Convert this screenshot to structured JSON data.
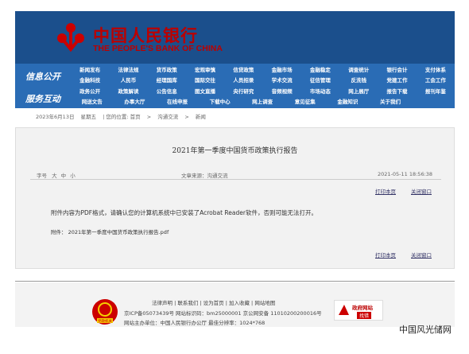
{
  "header": {
    "name_cn": "中国人民银行",
    "name_en": "THE PEOPLE'S BANK OF CHINA"
  },
  "nav": {
    "info_label": "信息公开",
    "service_label": "服务互动",
    "rows": [
      [
        "新闻发布",
        "法律法规",
        "货币政策",
        "宏观审慎",
        "信贷政策",
        "金融市场",
        "金融稳定",
        "调查统计",
        "银行会计",
        "支付体系"
      ],
      [
        "金融科技",
        "人民币",
        "经理国库",
        "国际交往",
        "人员招录",
        "学术交流",
        "征信管理",
        "反洗钱",
        "党建工作",
        "工会工作"
      ],
      [
        "政务公开",
        "政策解读",
        "公告信息",
        "图文直播",
        "央行研究",
        "音频视频",
        "市场动态",
        "网上展厅",
        "报告下载",
        "报刊年鉴"
      ],
      [
        "网送文告",
        "办事大厅",
        "在线申报",
        "下载中心",
        "网上调查",
        "意见征集",
        "金融知识",
        "关于我们",
        "",
        ""
      ]
    ]
  },
  "breadcrumb": {
    "date": "2023年6月13日",
    "weekday": "星期五",
    "location_label": "| 您的位置: 首页",
    "sep1": ">",
    "section": "沟通交流",
    "sep2": ">",
    "current": "新闻"
  },
  "article": {
    "title": "2021年第一季度中国货币政策执行报告",
    "font_size_label": "字号",
    "size_large": "大",
    "size_medium": "中",
    "size_small": "小",
    "source": "文章来源：沟通交流",
    "datetime": "2021-05-11  18:56:38",
    "print_label": "打印本页",
    "close_label": "关闭窗口",
    "notice": "附件内容为PDF格式，请确认您的计算机系统中已安装了Acrobat Reader软件，否则可能无法打开。",
    "attachment_label": "附件：",
    "attachment_file": "2021年第一季度中国货币政策执行报告.pdf"
  },
  "footer": {
    "links": [
      "法律声明",
      "联系我们",
      "设为首页",
      "加入收藏",
      "网站地图"
    ],
    "icp": "京ICP备05073439号  网站标识码：bm25000001  京公网安备 11010200200016号",
    "host": "网站主办单位：中国人民银行办公厅   最佳分辨率：1024*768",
    "badge_text": "党政机关",
    "gov_title": "政府网站",
    "gov_sub": "找错"
  },
  "watermark": "中国风光储网"
}
